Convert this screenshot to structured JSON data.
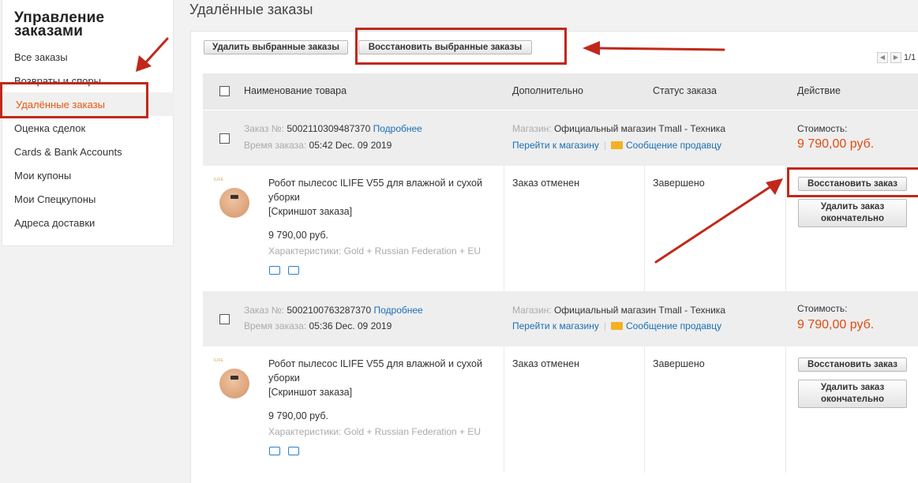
{
  "sidebar": {
    "title_line1": "Управление",
    "title_line2": "заказами",
    "items": [
      "Все заказы",
      "Возвраты и споры",
      "Удалённые заказы",
      "Оценка сделок",
      "Cards & Bank Accounts",
      "Мои купоны",
      "Мои Спецкупоны",
      "Адреса доставки"
    ],
    "active_index": 2
  },
  "page": {
    "heading": "Удалённые заказы",
    "delete_selected": "Удалить выбранные заказы",
    "restore_selected": "Восстановить выбранные заказы",
    "pager": "1/1"
  },
  "table": {
    "headers": [
      "Наименование товара",
      "Дополнительно",
      "Статус заказа",
      "Действие"
    ]
  },
  "orders": [
    {
      "order_label": "Заказ №:",
      "order_number": "5002110309487370",
      "details_link": "Подробнее",
      "time_label": "Время заказа:",
      "time": "05:42 Dec. 09 2019",
      "store_label": "Магазин:",
      "store": "Официальный магазин Tmall - Техника",
      "go_store": "Перейти к магазину",
      "message_seller": "Сообщение продавцу",
      "cost_label": "Стоимость:",
      "cost": "9 790,00 руб.",
      "product_name": "Робот пылесос ILIFE V55 для влажной и сухой уборки",
      "screenshot": "[Скриншот заказа]",
      "price": "9 790,00 руб.",
      "props": "Характеристики: Gold + Russian Federation + EU",
      "extra": "Заказ отменен",
      "status": "Завершено",
      "restore_btn": "Восстановить заказ",
      "delete_btn_line1": "Удалить заказ",
      "delete_btn_line2": "окончательно"
    },
    {
      "order_label": "Заказ №:",
      "order_number": "5002100763287370",
      "details_link": "Подробнее",
      "time_label": "Время заказа:",
      "time": "05:36 Dec. 09 2019",
      "store_label": "Магазин:",
      "store": "Официальный магазин Tmall - Техника",
      "go_store": "Перейти к магазину",
      "message_seller": "Сообщение продавцу",
      "cost_label": "Стоимость:",
      "cost": "9 790,00 руб.",
      "product_name": "Робот пылесос ILIFE V55 для влажной и сухой уборки",
      "screenshot": "[Скриншот заказа]",
      "price": "9 790,00 руб.",
      "props": "Характеристики: Gold + Russian Federation + EU",
      "extra": "Заказ отменен",
      "status": "Завершено",
      "restore_btn": "Восстановить заказ",
      "delete_btn_line1": "Удалить заказ",
      "delete_btn_line2": "окончательно"
    }
  ],
  "thumb_logo": "ILIFE",
  "colors": {
    "accent_orange": "#e8580c",
    "price_red": "#e14b10",
    "link_blue": "#1a6fb5",
    "annotation_red": "#c0281b"
  }
}
